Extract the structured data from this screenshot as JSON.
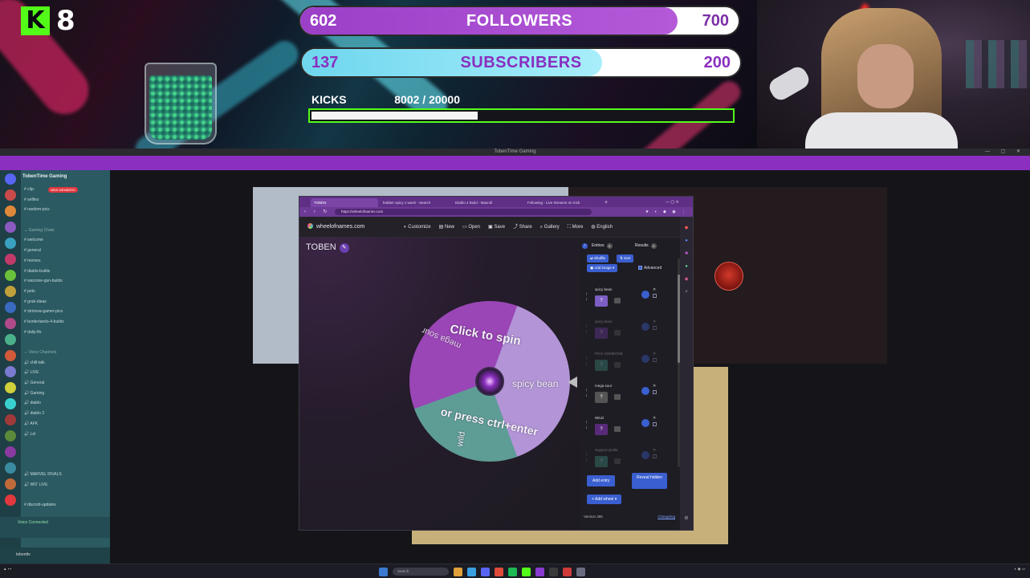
{
  "overlay": {
    "kick_count": "8",
    "followers": {
      "current": "602",
      "label": "FOLLOWERS",
      "goal": "700",
      "progress": 0.86,
      "color": "#9b3fc8"
    },
    "subscribers": {
      "current": "137",
      "label": "SUBSCRIBERS",
      "goal": "200",
      "progress": 0.685,
      "color": "#6ed6ee"
    },
    "kicks": {
      "label": "KICKS",
      "value": "8002 / 20000",
      "progress": 0.4,
      "color": "#53fc18"
    }
  },
  "obs": {
    "title": "TobenTime Gaming"
  },
  "discord": {
    "server_name": "TobenTime Gaming",
    "live_badge": "NEW MEMBERS",
    "channels": [
      {
        "label": "clip-",
        "type": "text"
      },
      {
        "label": "selfies",
        "type": "text"
      },
      {
        "label": "random-pics",
        "type": "text"
      },
      {
        "label": "",
        "type": "gap"
      },
      {
        "label": "Gaming Chats",
        "type": "cat"
      },
      {
        "label": "welcome",
        "type": "text"
      },
      {
        "label": "general",
        "type": "text"
      },
      {
        "label": "memes",
        "type": "text"
      },
      {
        "label": "diablo-builds",
        "type": "text"
      },
      {
        "label": "warzone-gun-builds",
        "type": "text"
      },
      {
        "label": "pets",
        "type": "text"
      },
      {
        "label": "grub-ideas",
        "type": "text"
      },
      {
        "label": "strinova-gamer-pics",
        "type": "text"
      },
      {
        "label": "borderlands-4-builds",
        "type": "text"
      },
      {
        "label": "daily-lfo",
        "type": "text"
      },
      {
        "label": "",
        "type": "gap"
      },
      {
        "label": "Voice Channels",
        "type": "cat"
      },
      {
        "label": "chill-talk",
        "type": "voice"
      },
      {
        "label": "LIVE",
        "type": "voice"
      },
      {
        "label": "General",
        "type": "voice"
      },
      {
        "label": "Gaming",
        "type": "voice"
      },
      {
        "label": "diablo",
        "type": "voice"
      },
      {
        "label": "diablo 2",
        "type": "voice"
      },
      {
        "label": "AFK",
        "type": "voice"
      },
      {
        "label": "Lol",
        "type": "voice"
      },
      {
        "label": "",
        "type": "gap"
      },
      {
        "label": "",
        "type": "gap"
      },
      {
        "label": "",
        "type": "gap"
      },
      {
        "label": "MARVEL RIVALS",
        "type": "voice"
      },
      {
        "label": "WO' LIVE",
        "type": "voice"
      },
      {
        "label": "",
        "type": "gap"
      },
      {
        "label": "discord-updates",
        "type": "text"
      },
      {
        "label": "",
        "type": "gap"
      },
      {
        "label": "",
        "type": "gap"
      }
    ],
    "voice_status": "Voice Connected",
    "user": "tobenttv"
  },
  "browser": {
    "tabs": [
      {
        "label": "TOBEN",
        "active": true
      },
      {
        "label": "bobber spicy 1 week - Search",
        "active": false
      },
      {
        "label": "Diablo 4 Build - Maxroll",
        "active": false
      },
      {
        "label": "Following - Live Streams on Kick",
        "active": false
      }
    ],
    "url": "https://wheelofnames.com"
  },
  "won": {
    "brand": "wheelofnames.com",
    "menu": [
      {
        "label": "Customize",
        "icon": "palette-icon"
      },
      {
        "label": "New",
        "icon": "new-file-icon"
      },
      {
        "label": "Open",
        "icon": "folder-icon"
      },
      {
        "label": "Save",
        "icon": "save-icon"
      },
      {
        "label": "Share",
        "icon": "share-icon"
      },
      {
        "label": "Gallery",
        "icon": "search-icon"
      },
      {
        "label": "More",
        "icon": "fullscreen-icon"
      },
      {
        "label": "English",
        "icon": "globe-icon"
      }
    ],
    "title": "TOBEN",
    "wheel_text": {
      "spin": "Click to spin",
      "press": "or press ctrl+enter",
      "spicy": "spicy bean",
      "mega": "mega sour",
      "wild": "wild"
    },
    "panel": {
      "entries_tab": "Entries",
      "entries_count": "5",
      "results_tab": "Results",
      "results_count": "0",
      "shuffle": "Shuffle",
      "sort": "Sort",
      "add_image": "Add image",
      "advanced": "Advanced",
      "entries": [
        {
          "name": "spicy bean",
          "color": "#7d5ec4",
          "dim": false
        },
        {
          "name": "spicy bean",
          "color": "#6a3aa0",
          "dim": true
        },
        {
          "name": "PICK SOMEONE",
          "color": "#3a8a7a",
          "dim": true
        },
        {
          "name": "mega sour",
          "color": "#555",
          "dim": false
        },
        {
          "name": "WILD",
          "color": "#5a2a7a",
          "dim": false
        },
        {
          "name": "Support pickle",
          "color": "#3a8a7a",
          "dim": true
        }
      ],
      "add_entry": "Add entry",
      "reveal_hidden": "Reveal hidden",
      "add_wheel": "Add wheel",
      "version": "Version 395",
      "changelog": "Changelog"
    }
  },
  "taskbar": {
    "search": "Search"
  }
}
